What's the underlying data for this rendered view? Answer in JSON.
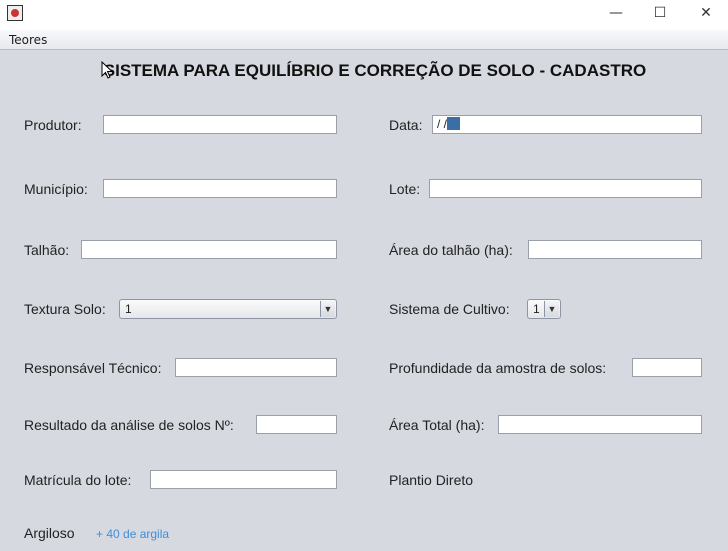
{
  "window": {
    "minimize": "—",
    "maximize": "☐",
    "close": "✕"
  },
  "menu": {
    "items": [
      "Teores"
    ]
  },
  "heading": "SISTEMA PARA EQUILÍBRIO E CORREÇÃO DE SOLO - CADASTRO",
  "form": {
    "produtor": {
      "label": "Produtor:",
      "value": ""
    },
    "data": {
      "label": "Data:",
      "value": " /  /"
    },
    "municipio": {
      "label": "Município:",
      "value": ""
    },
    "lote": {
      "label": "Lote:",
      "value": ""
    },
    "talhao": {
      "label": "Talhão:",
      "value": ""
    },
    "area_talhao": {
      "label": "Área do talhão (ha):",
      "value": ""
    },
    "textura_solo": {
      "label": "Textura Solo:",
      "value": "1"
    },
    "sistema_cultivo": {
      "label": "Sistema de Cultivo:",
      "value": "1"
    },
    "responsavel": {
      "label": "Responsável Técnico:",
      "value": ""
    },
    "profundidade": {
      "label": "Profundidade da amostra de solos:",
      "value": ""
    },
    "resultado": {
      "label": "Resultado da análise de solos Nº:",
      "value": ""
    },
    "area_total": {
      "label": "Área Total (ha):",
      "value": ""
    },
    "matricula": {
      "label": "Matrícula do lote:",
      "value": ""
    },
    "plantio_direto": "Plantio Direto",
    "argiloso": "Argiloso",
    "argila_note": "+ 40 de argila"
  }
}
